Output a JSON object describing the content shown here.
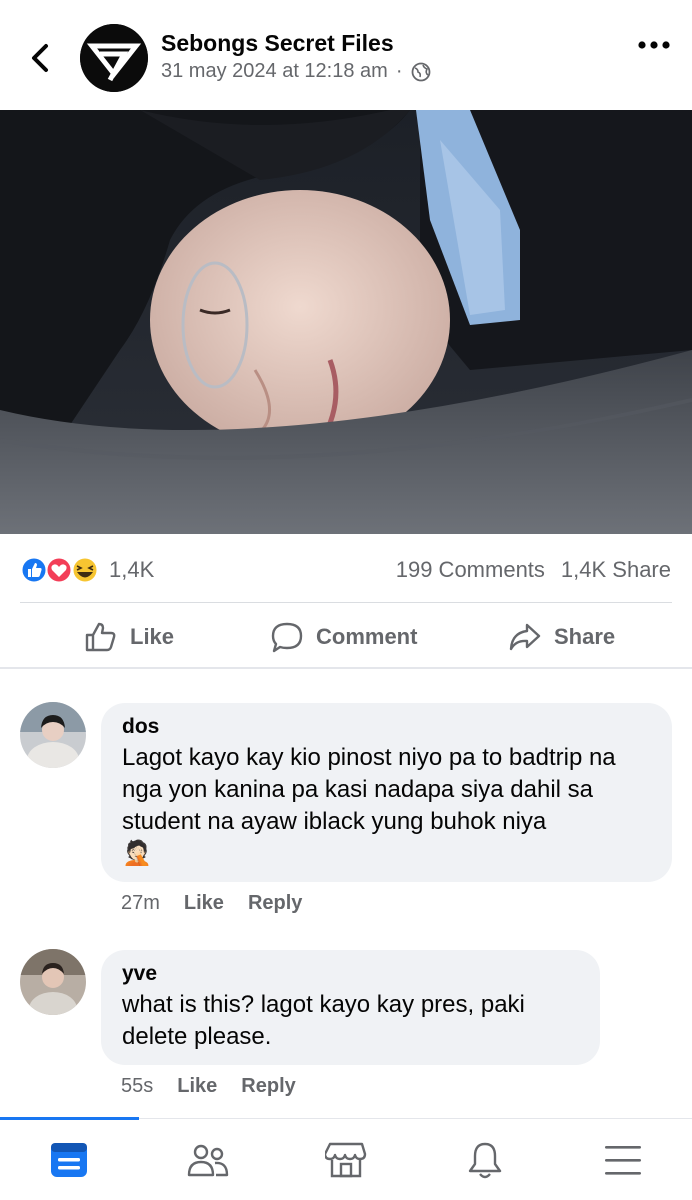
{
  "header": {
    "page_name": "Sebongs Secret Files",
    "timestamp": "31 may 2024 at 12:18 am",
    "separator": "·",
    "back_icon": "chevron-left-icon",
    "more_icon": "more-horizontal-icon",
    "privacy_icon": "globe-icon"
  },
  "post": {
    "photo_description": "photo"
  },
  "stats": {
    "reaction_types": [
      "like",
      "love",
      "haha"
    ],
    "reaction_count": "1,4K",
    "comments": "199 Comments",
    "shares": "1,4K Share"
  },
  "actions": {
    "like": "Like",
    "comment": "Comment",
    "share": "Share"
  },
  "comments": [
    {
      "author": "dos",
      "text": "Lagot kayo kay kio pinost niyo pa to badtrip na nga yon kanina pa kasi nadapa siya dahil sa student na ayaw iblack yung buhok niya",
      "emoji": "🤦🏻",
      "time": "27m",
      "like": "Like",
      "reply": "Reply"
    },
    {
      "author": "yve",
      "text": "what is this? lagot kayo kay pres, paki delete please.",
      "time": "55s",
      "like": "Like",
      "reply": "Reply"
    }
  ],
  "tabbar": {
    "active": "feed",
    "tabs": [
      "feed-icon",
      "friends-icon",
      "marketplace-icon",
      "notifications-icon",
      "menu-icon"
    ]
  },
  "colors": {
    "accent": "#1877f2",
    "secondary_text": "#65676b",
    "bubble": "#f0f2f5"
  }
}
